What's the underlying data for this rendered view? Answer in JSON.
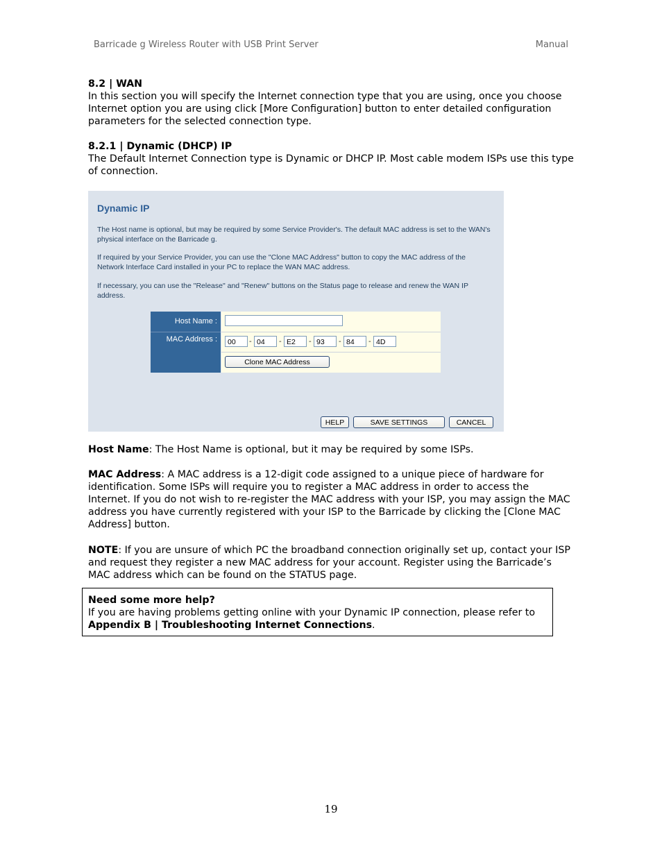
{
  "header": {
    "left": "Barricade g Wireless Router with USB Print Server",
    "right": "Manual"
  },
  "section_8_2": {
    "heading": "8.2 | WAN",
    "body": "In this section you will specify the Internet connection type that you are using, once you choose Internet option you are using click [More Configuration] button to enter detailed configuration parameters for the selected connection type."
  },
  "section_8_2_1": {
    "heading": "8.2.1 | Dynamic (DHCP) IP",
    "body": "The Default Internet Connection type is Dynamic or DHCP IP.  Most cable modem ISPs use this type of connection."
  },
  "screenshot": {
    "title": "Dynamic IP",
    "paragraphs": [
      "The Host name is optional, but may be required by some Service Provider's. The default MAC address is set to the WAN's physical interface on the Barricade g.",
      "If required by your Service Provider, you can use the \"Clone MAC Address\" button to copy the MAC address of the Network Interface Card installed in your PC to replace the WAN MAC address.",
      "If necessary, you can use the \"Release\" and \"Renew\" buttons on the Status page to release and renew the WAN IP address."
    ],
    "form": {
      "host_name_label": "Host Name :",
      "host_name_value": "",
      "mac_label": "MAC Address :",
      "mac_octets": [
        "00",
        "04",
        "E2",
        "93",
        "84",
        "4D"
      ],
      "mac_separator": "-",
      "clone_button": "Clone MAC Address"
    },
    "buttons": {
      "help": "HELP",
      "save": "SAVE SETTINGS",
      "cancel": "CANCEL"
    }
  },
  "definitions": {
    "host_name": {
      "term": "Host Name",
      "text": ": The Host Name is optional, but it may be required by some ISPs."
    },
    "mac_address": {
      "term": "MAC Address",
      "text": ": A MAC address is a 12-digit code assigned to a unique piece of hardware for identification. Some ISPs will require you to register a MAC address in order to access the Internet. If you do not wish to re-register the MAC address with your ISP, you may assign the MAC address you have currently registered with your ISP to the Barricade by clicking the [Clone MAC Address] button."
    },
    "note": {
      "term": "NOTE",
      "text": ": If you are unsure of which PC the broadband connection originally set up, contact your ISP and request they register a new MAC address for your account. Register using the Barricade’s MAC address which can be found on the STATUS page."
    }
  },
  "help_box": {
    "title": "Need some more help?",
    "text": "If you are having problems getting online with your Dynamic IP connection, please refer to ",
    "link": "Appendix B | Troubleshooting Internet Connections",
    "suffix": "."
  },
  "page_number": "19"
}
